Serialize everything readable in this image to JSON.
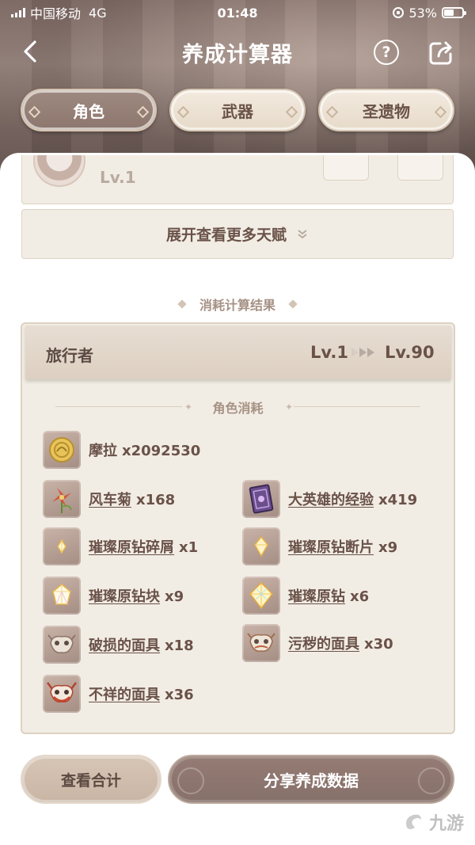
{
  "status_bar": {
    "carrier": "中国移动",
    "network": "4G",
    "time": "01:48",
    "battery": "53%"
  },
  "nav": {
    "title": "养成计算器"
  },
  "tabs": [
    {
      "label": "角色",
      "active": true
    },
    {
      "label": "武器",
      "active": false
    },
    {
      "label": "圣遗物",
      "active": false
    }
  ],
  "partial_row": {
    "level": "Lv.1"
  },
  "expand_button": {
    "label": "展开查看更多天赋"
  },
  "results": {
    "section_title": "消耗计算结果",
    "character": {
      "name": "旅行者",
      "level_from": "Lv.1",
      "level_to": "Lv.90"
    },
    "subsection_title": "角色消耗",
    "materials": [
      {
        "name": "摩拉",
        "qty": "x2092530",
        "icon": "mora-coin-icon",
        "link": false
      },
      {
        "name": "风车菊",
        "qty": "x168",
        "icon": "windwheel-aster-icon",
        "link": true
      },
      {
        "name": "大英雄的经验",
        "qty": "x419",
        "icon": "heros-wit-book-icon",
        "link": true
      },
      {
        "name": "璀璨原钻碎屑",
        "qty": "x1",
        "icon": "gem-sliver-icon",
        "link": true
      },
      {
        "name": "璀璨原钻断片",
        "qty": "x9",
        "icon": "gem-fragment-icon",
        "link": true
      },
      {
        "name": "璀璨原钻块",
        "qty": "x9",
        "icon": "gem-chunk-icon",
        "link": true
      },
      {
        "name": "璀璨原钻",
        "qty": "x6",
        "icon": "gemstone-icon",
        "link": true
      },
      {
        "name": "破损的面具",
        "qty": "x18",
        "icon": "damaged-mask-icon",
        "link": true
      },
      {
        "name": "污秽的面具",
        "qty": "x30",
        "icon": "stained-mask-icon",
        "link": true
      },
      {
        "name": "不祥的面具",
        "qty": "x36",
        "icon": "ominous-mask-icon",
        "link": true
      }
    ]
  },
  "buttons": {
    "total": "查看合计",
    "share": "分享养成数据"
  },
  "watermark": "九游",
  "colors": {
    "accent": "#8c766e",
    "card_bg": "#f2ede4",
    "text_brown": "#6a5249"
  }
}
